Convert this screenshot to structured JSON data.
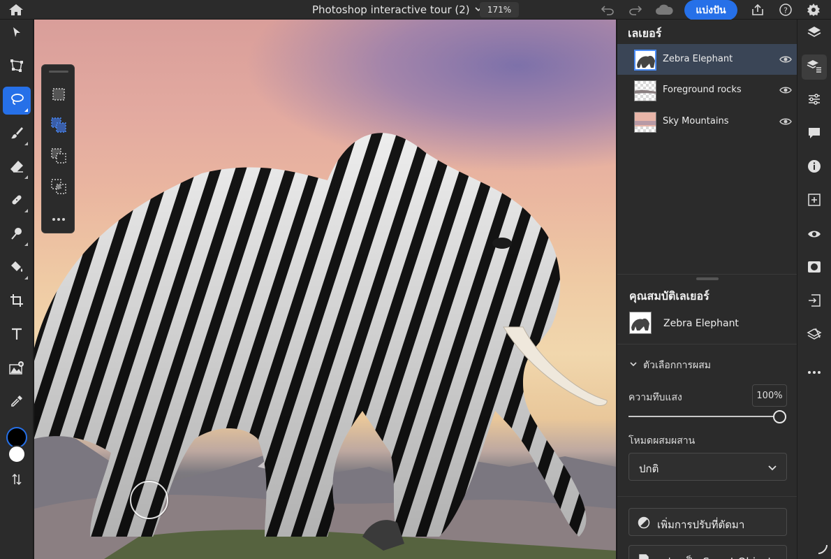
{
  "topbar": {
    "document_title": "Photoshop interactive tour (2)",
    "zoom": "171%",
    "share_label": "แบ่งปัน",
    "icons": [
      "home-icon",
      "chevron-down-icon",
      "undo-icon",
      "redo-icon",
      "cloud-icon",
      "export-icon",
      "help-icon",
      "settings-icon"
    ]
  },
  "tools": {
    "items": [
      "move-tool",
      "transform-tool",
      "lasso-tool",
      "brush-tool",
      "eraser-tool",
      "healing-tool",
      "dodge-tool",
      "paint-bucket-tool",
      "crop-tool",
      "type-tool",
      "place-image-tool",
      "eyedropper-tool",
      "foreground-color",
      "background-color",
      "swap-colors"
    ],
    "active": "lasso-tool",
    "foreground_color": "#000000",
    "background_color": "#ffffff"
  },
  "selection_options": {
    "items": [
      "new-selection",
      "add-to-selection",
      "subtract-from-selection",
      "intersect-selection",
      "more-options"
    ],
    "active": "add-to-selection"
  },
  "layers_panel": {
    "title": "เลเยอร์",
    "layers": [
      {
        "name": "Zebra Elephant",
        "visible": true,
        "selected": true
      },
      {
        "name": "Foreground rocks",
        "visible": true,
        "selected": false
      },
      {
        "name": "Sky Mountains",
        "visible": true,
        "selected": false
      }
    ]
  },
  "layer_properties": {
    "title": "คุณสมบัติเลเยอร์",
    "layer_name": "Zebra Elephant",
    "blend_options_label": "ตัวเลือกการผสม",
    "opacity_label": "ความทึบแสง",
    "opacity_value": "100%",
    "opacity_fraction": 1.0,
    "blend_mode_label": "โหมดผสมผสาน",
    "blend_mode_value": "ปกติ",
    "add_adjustment_label": "เพิ่มการปรับที่ตัดมา",
    "convert_smart_object_label": "แปลงเป็น Smart Object"
  },
  "rail": {
    "items": [
      "layers-icon",
      "layer-properties-icon",
      "adjustments-icon",
      "comments-icon",
      "info-icon",
      "add-layer-icon",
      "visibility-icon",
      "mask-icon",
      "import-icon",
      "eraser-layer-icon",
      "more-icon"
    ],
    "active": "layer-properties-icon"
  },
  "colors": {
    "accent": "#2670e8",
    "panel_bg": "#2b2b2b",
    "selected_row": "#3a4556"
  }
}
